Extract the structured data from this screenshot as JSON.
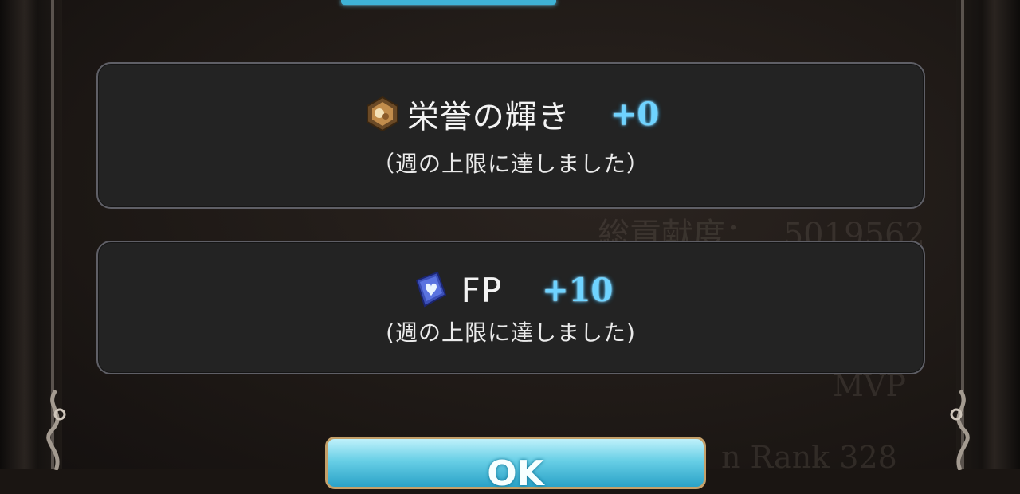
{
  "rewards": [
    {
      "name": "栄誉の輝き",
      "amount": "+0",
      "note": "（週の上限に達しました）",
      "icon": "honor-shine-icon"
    },
    {
      "name": "FP",
      "amount": "+10",
      "note": "(週の上限に達しました)",
      "icon": "fp-heart-crystal-icon"
    }
  ],
  "background": {
    "contribution_label": "総貢献度：",
    "contribution_value": "5019562",
    "rank_text": "n Rank 328",
    "mvp_text": "MVP"
  },
  "ok_button": {
    "label": "OK"
  },
  "colors": {
    "accent_blue": "#6fd3ff",
    "panel_bg": "#232323",
    "panel_border": "#5f5f66"
  }
}
